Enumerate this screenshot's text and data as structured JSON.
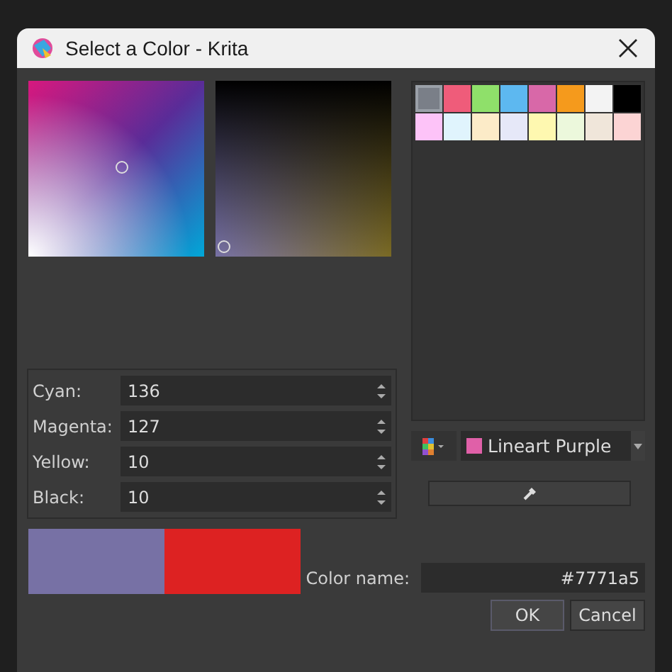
{
  "window": {
    "title": "Select a Color - Krita"
  },
  "fields": [
    {
      "label": "Cyan:",
      "value": "136"
    },
    {
      "label": "Magenta:",
      "value": "127"
    },
    {
      "label": "Yellow:",
      "value": "10"
    },
    {
      "label": "Black:",
      "value": "10"
    }
  ],
  "swatches": [
    {
      "color": "#7a7f88",
      "selected": true
    },
    {
      "color": "#ef5c7a",
      "selected": false
    },
    {
      "color": "#8fe06a",
      "selected": false
    },
    {
      "color": "#5db8f0",
      "selected": false
    },
    {
      "color": "#d868a8",
      "selected": false
    },
    {
      "color": "#f59a1c",
      "selected": false
    },
    {
      "color": "#f3f3f3",
      "selected": false
    },
    {
      "color": "#000000",
      "selected": false
    },
    {
      "color": "#fdc3f8",
      "selected": false
    },
    {
      "color": "#e0f4fd",
      "selected": false
    },
    {
      "color": "#fcebc8",
      "selected": false
    },
    {
      "color": "#e6e8f8",
      "selected": false
    },
    {
      "color": "#fef8b0",
      "selected": false
    },
    {
      "color": "#ecf8dc",
      "selected": false
    },
    {
      "color": "#f0e6da",
      "selected": false
    },
    {
      "color": "#fcd4d4",
      "selected": false
    }
  ],
  "palette": {
    "name": "Lineart Purple",
    "color": "#e060a8"
  },
  "preview": [
    {
      "color": "#7771a5"
    },
    {
      "color": "#dd2222"
    }
  ],
  "color_name": {
    "label": "Color name:",
    "value": "#7771a5"
  },
  "buttons": [
    "OK",
    "Cancel"
  ]
}
